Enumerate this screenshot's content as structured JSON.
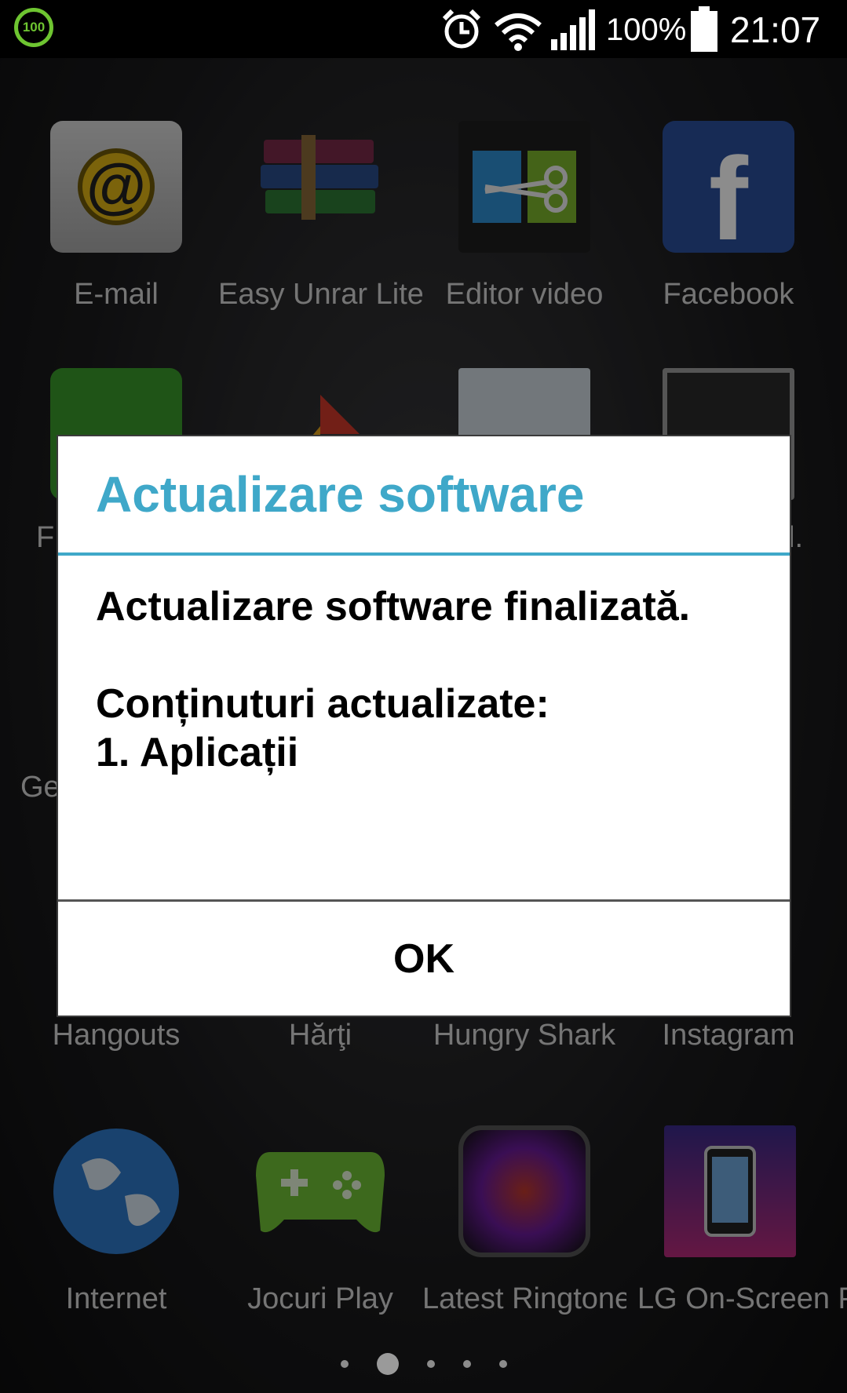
{
  "status_bar": {
    "battery_badge": "100",
    "battery_percent": "100%",
    "time": "21:07",
    "icons": [
      "alarm-icon",
      "wifi-icon",
      "signal-icon",
      "battery-icon"
    ]
  },
  "apps": {
    "row1": [
      {
        "label": "E-mail",
        "icon": "email-icon"
      },
      {
        "label": "Easy Unrar Lite",
        "icon": "books-icon"
      },
      {
        "label": "Editor video",
        "icon": "scissors-film-icon"
      },
      {
        "label": "Facebook",
        "icon": "facebook-icon"
      }
    ],
    "row_partial_labels": {
      "left": "F",
      "right": "l.",
      "left2": "Ges"
    },
    "row4": [
      {
        "label": "Hangouts"
      },
      {
        "label": "Hărţi"
      },
      {
        "label": "Hungry Shark"
      },
      {
        "label": "Instagram"
      }
    ],
    "row5": [
      {
        "label": "Internet",
        "icon": "globe-icon"
      },
      {
        "label": "Jocuri Play",
        "icon": "gamepad-icon"
      },
      {
        "label": "Latest Ringtones",
        "icon": "ringtones-icon"
      },
      {
        "label": "LG  On-Screen Pl",
        "icon": "monitor-phone-icon"
      }
    ]
  },
  "dialog": {
    "title": "Actualizare software",
    "message_line1": "Actualizare software finalizată.",
    "message_line2": "Conținuturi actualizate:",
    "message_line3": "1. Aplicații",
    "ok_label": "OK"
  },
  "colors": {
    "accent": "#3fa8c9",
    "battery_green": "#6ec531"
  }
}
